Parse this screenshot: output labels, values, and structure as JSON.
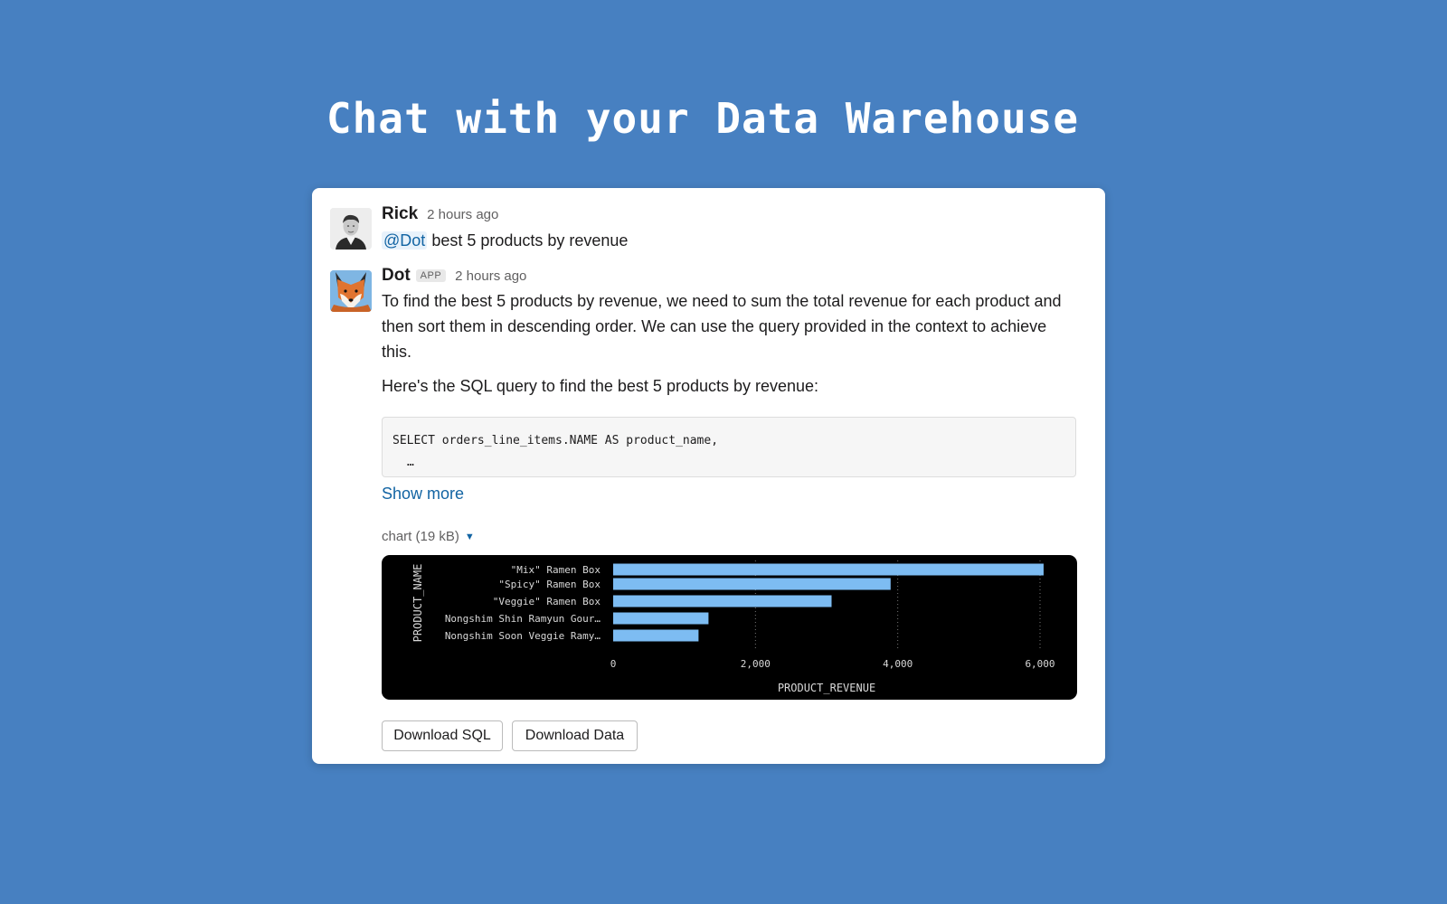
{
  "hero": {
    "title": "Chat with your Data Warehouse"
  },
  "messages": {
    "user": {
      "name": "Rick",
      "time": "2 hours ago",
      "mention": "@Dot",
      "text": "best 5 products by revenue"
    },
    "bot": {
      "name": "Dot",
      "badge": "APP",
      "time": "2 hours ago",
      "paragraph1": "To find the best 5 products by revenue, we need to sum the total revenue for each product and then sort them in descending order. We can use the query provided in the context to achieve this.",
      "paragraph2": "Here's the SQL query to find the best 5 products by revenue:",
      "code_line1": "SELECT orders_line_items.NAME AS product_name,",
      "code_line2": "…",
      "show_more": "Show more",
      "file_label": "chart (19 kB)"
    }
  },
  "chart_data": {
    "type": "bar",
    "orientation": "horizontal",
    "categories": [
      "\"Mix\" Ramen Box",
      "\"Spicy\" Ramen Box",
      "\"Veggie\" Ramen Box",
      "Nongshim Shin Ramyun Gour…",
      "Nongshim Soon Veggie Ramy…"
    ],
    "values": [
      6050,
      3900,
      3070,
      1340,
      1200
    ],
    "xlabel": "PRODUCT_REVENUE",
    "ylabel": "PRODUCT_NAME",
    "xticks": [
      0,
      2000,
      4000,
      6000
    ],
    "xtick_labels": [
      "0",
      "2,000",
      "4,000",
      "6,000"
    ],
    "xlim": [
      0,
      6000
    ],
    "grid": true,
    "colors": {
      "bar": "#7dbcf2",
      "background": "#000000",
      "text": "#d8d8d8"
    }
  },
  "buttons": {
    "download_sql": "Download SQL",
    "download_data": "Download Data"
  }
}
